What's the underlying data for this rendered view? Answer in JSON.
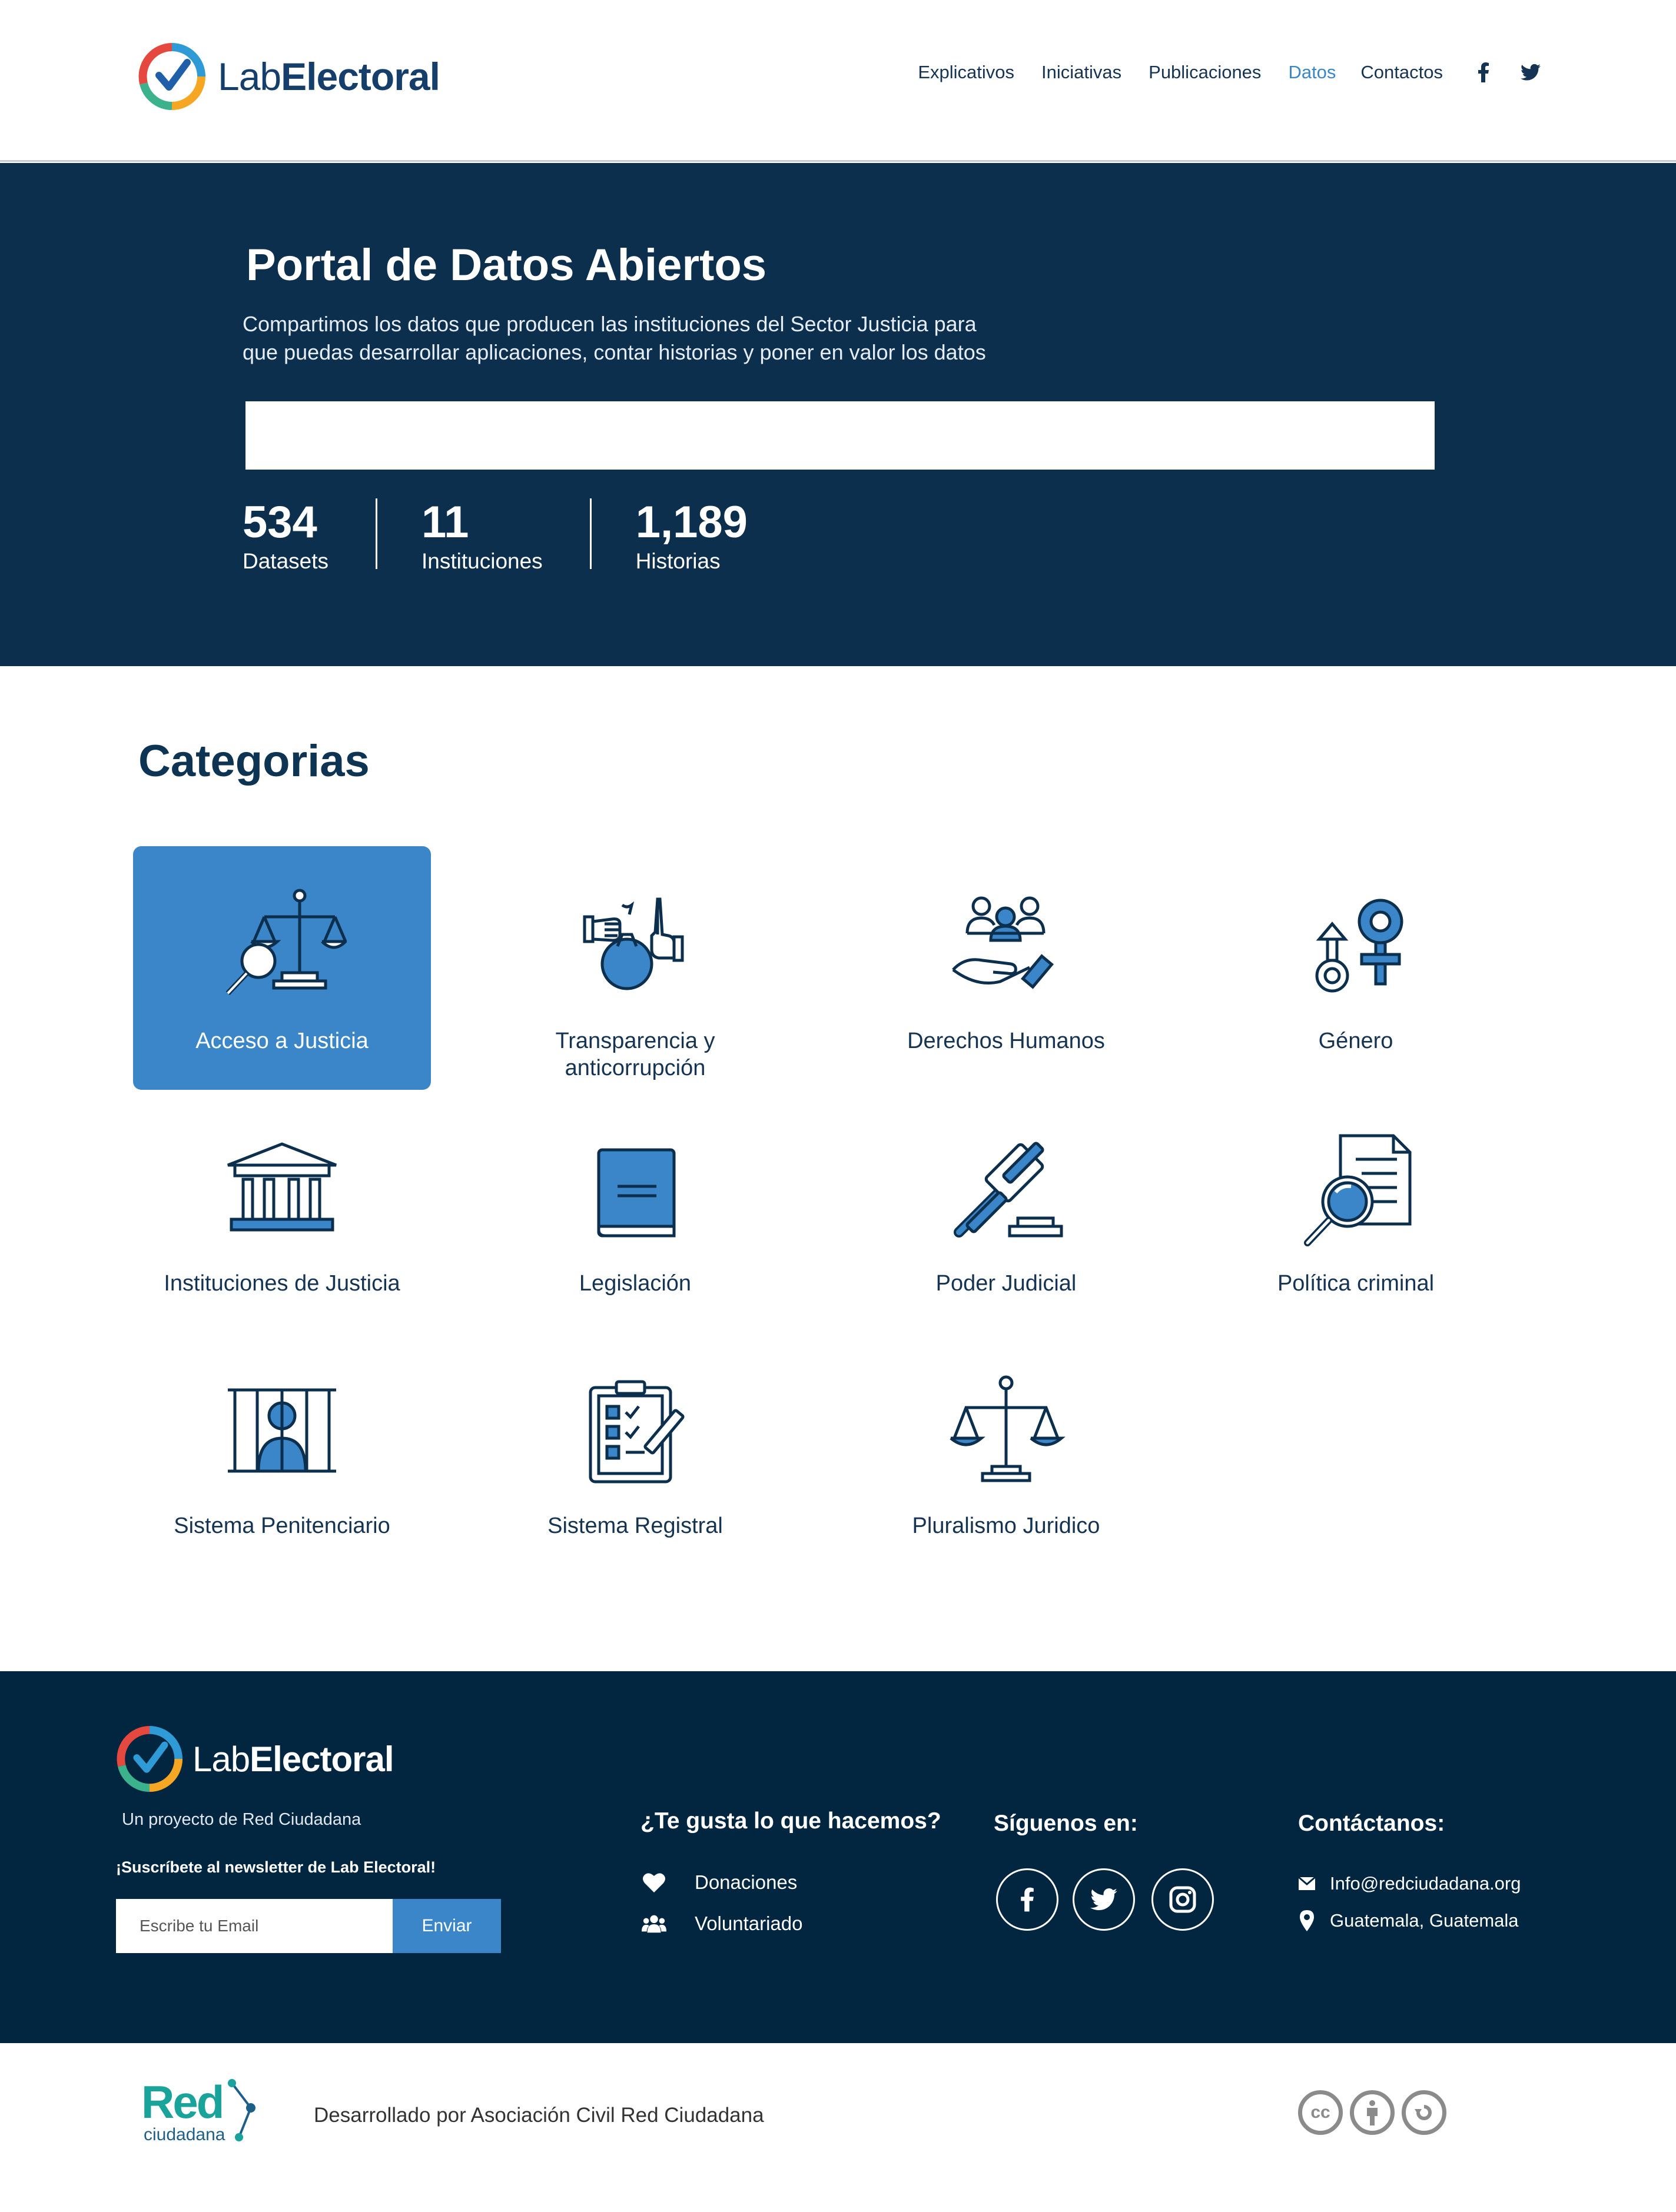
{
  "header": {
    "logo_light": "Lab",
    "logo_bold": "Electoral",
    "nav": [
      "Explicativos",
      "Iniciativas",
      "Publicaciones",
      "Datos",
      "Contactos"
    ],
    "active_nav": "Datos",
    "social_icons": [
      "facebook-icon",
      "twitter-icon"
    ]
  },
  "hero": {
    "title": "Portal de Datos Abiertos",
    "description_line1": "Compartimos los datos que producen las instituciones del Sector Justicia para",
    "description_line2": "que puedas desarrollar aplicaciones, contar historias y poner en valor los datos",
    "search_value": "",
    "stats": [
      {
        "value": "534",
        "label": "Datasets"
      },
      {
        "value": "11",
        "label": "Instituciones"
      },
      {
        "value": "1,189",
        "label": "Historias"
      }
    ]
  },
  "categories": {
    "title": "Categorias",
    "items": [
      {
        "label": "Acceso a Justicia",
        "icon": "scales-magnifier-icon",
        "selected": true
      },
      {
        "label": "Transparencia y\nanticorrupción",
        "icon": "bribe-refuse-icon",
        "selected": false
      },
      {
        "label": "Derechos Humanos",
        "icon": "people-hand-icon",
        "selected": false
      },
      {
        "label": "Género",
        "icon": "gender-symbols-icon",
        "selected": false
      },
      {
        "label": "Instituciones de Justicia",
        "icon": "courthouse-icon",
        "selected": false
      },
      {
        "label": "Legislación",
        "icon": "book-icon",
        "selected": false
      },
      {
        "label": "Poder Judicial",
        "icon": "gavel-icon",
        "selected": false
      },
      {
        "label": "Política criminal",
        "icon": "document-magnifier-icon",
        "selected": false
      },
      {
        "label": "Sistema Penitenciario",
        "icon": "prisoner-bars-icon",
        "selected": false
      },
      {
        "label": "Sistema Registral",
        "icon": "clipboard-checklist-icon",
        "selected": false
      },
      {
        "label": "Pluralismo Juridico",
        "icon": "scales-icon",
        "selected": false
      }
    ]
  },
  "footer": {
    "logo_light": "Lab",
    "logo_bold": "Electoral",
    "subtitle": "Un proyecto de Red Ciudadana",
    "newsletter": "¡Suscríbete al newsletter de Lab Electoral!",
    "email_placeholder": "Escribe tu Email",
    "send_label": "Enviar",
    "like_title": "¿Te gusta lo que hacemos?",
    "like_items": [
      "Donaciones",
      "Voluntariado"
    ],
    "follow_title": "Síguenos en:",
    "contact_title": "Contáctanos:",
    "email": "Info@redciudadana.org",
    "location": "Guatemala, Guatemala"
  },
  "bottom": {
    "red_logo_top": "Red",
    "red_logo_bottom": "ciudadana",
    "developed_by": "Desarrollado por Asociación Civil Red Ciudadana",
    "license_icons": [
      "cc-icon",
      "attribution-icon",
      "sharealike-icon"
    ]
  },
  "colors": {
    "navy": "#0d2f4e",
    "footer": "#022540",
    "accent": "#3a86c8"
  }
}
